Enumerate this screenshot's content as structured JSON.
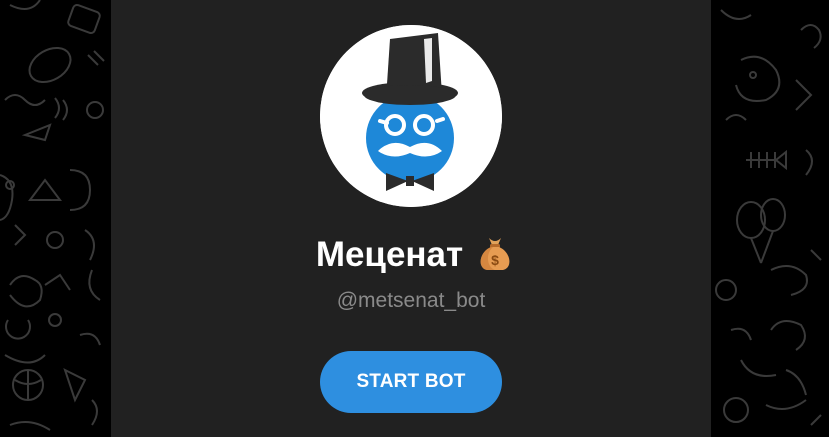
{
  "bot": {
    "name": "Меценат",
    "username": "@metsenat_bot",
    "emoji_icon": "money-bag-icon"
  },
  "actions": {
    "start_label": "START BOT"
  },
  "colors": {
    "background": "#000000",
    "card": "#212121",
    "accent": "#2e8fe0",
    "avatar_face": "#1e88d8",
    "username": "#8a8a8a"
  }
}
